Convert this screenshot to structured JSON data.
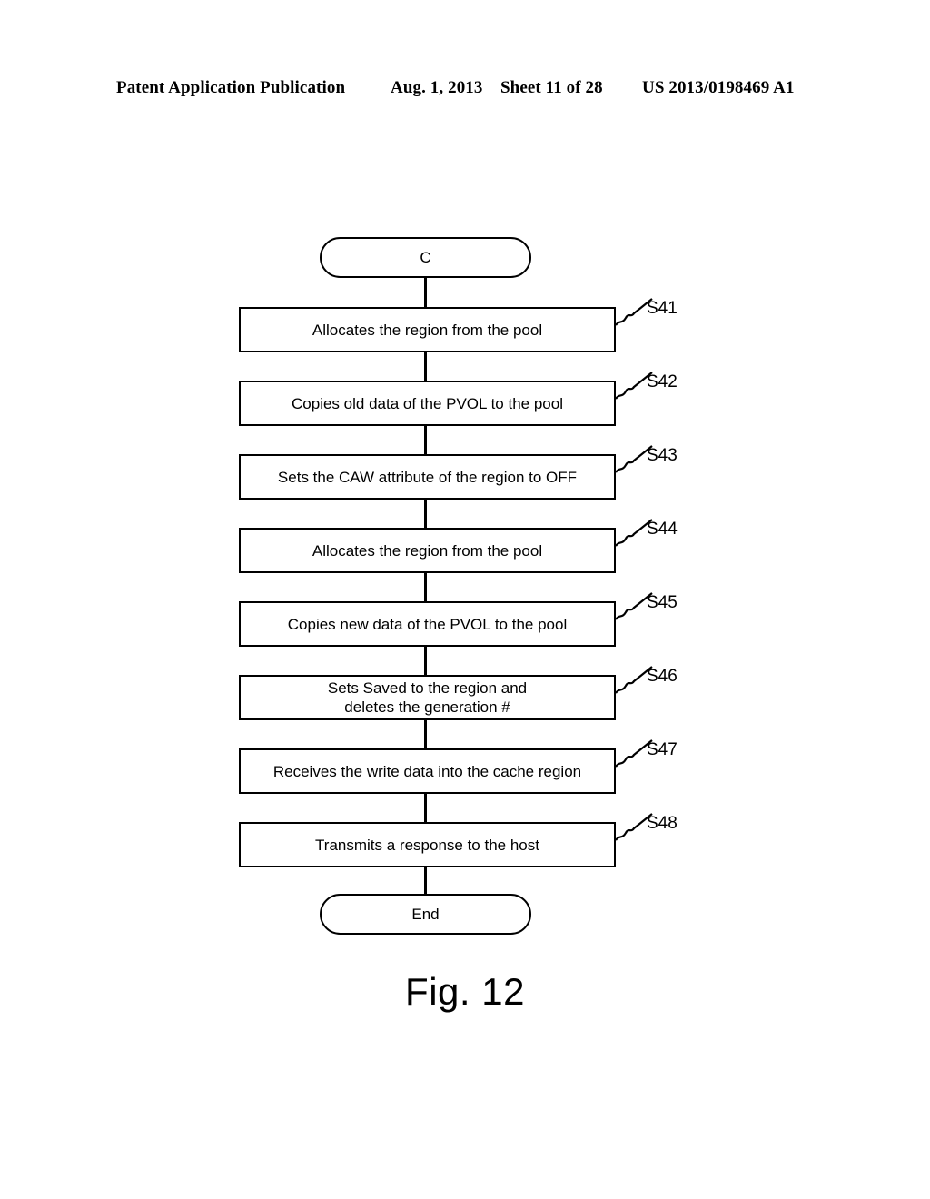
{
  "header": {
    "publication": "Patent Application Publication",
    "date": "Aug. 1, 2013",
    "sheet": "Sheet 11 of 28",
    "patent_number": "US 2013/0198469 A1"
  },
  "figure": {
    "caption": "Fig. 12"
  },
  "flowchart": {
    "start_terminal": "C",
    "end_terminal": "End",
    "steps": [
      {
        "id": "S41",
        "text": "Allocates the region from the pool"
      },
      {
        "id": "S42",
        "text": "Copies old data of the PVOL to the pool"
      },
      {
        "id": "S43",
        "text": "Sets the CAW attribute of the region to OFF"
      },
      {
        "id": "S44",
        "text": "Allocates the region from the pool"
      },
      {
        "id": "S45",
        "text": "Copies new data of the PVOL to the pool"
      },
      {
        "id": "S46",
        "text": "Sets Saved to the region and",
        "text2": "deletes the generation #"
      },
      {
        "id": "S47",
        "text": "Receives the write data into the cache region"
      },
      {
        "id": "S48",
        "text": "Transmits a response to the host"
      }
    ]
  },
  "colors": {
    "ink": "#000000",
    "page": "#ffffff"
  }
}
